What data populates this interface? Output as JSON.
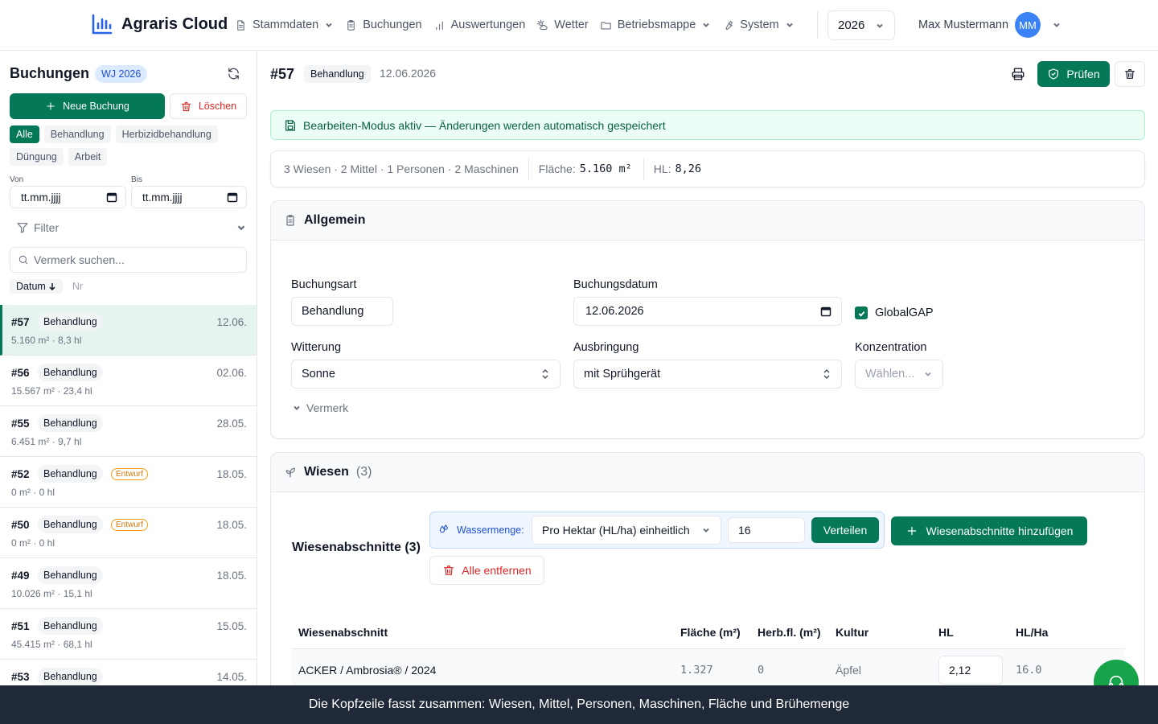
{
  "app": {
    "title": "Agraris Cloud",
    "accent_color": "#047857",
    "nav": [
      {
        "label": "Stammdaten",
        "icon": "document-icon",
        "dropdown": true
      },
      {
        "label": "Buchungen",
        "icon": "clipboard-icon",
        "dropdown": false
      },
      {
        "label": "Auswertungen",
        "icon": "bar-chart-icon",
        "dropdown": false
      },
      {
        "label": "Wetter",
        "icon": "weather-icon",
        "dropdown": false
      },
      {
        "label": "Betriebsmappe",
        "icon": "folder-icon",
        "dropdown": true
      },
      {
        "label": "System",
        "icon": "wrench-icon",
        "dropdown": true
      }
    ],
    "year": "2026",
    "user": {
      "name": "Max Mustermann",
      "initials": "MM"
    }
  },
  "sidebar": {
    "title": "Buchungen",
    "wj_badge": "WJ 2026",
    "new_label": "Neue Buchung",
    "delete_label": "Löschen",
    "chips": [
      {
        "label": "Alle",
        "active": true
      },
      {
        "label": "Behandlung",
        "active": false
      },
      {
        "label": "Herbizidbehandlung",
        "active": false
      },
      {
        "label": "Düngung",
        "active": false
      },
      {
        "label": "Arbeit",
        "active": false
      }
    ],
    "von_label": "Von",
    "bis_label": "Bis",
    "date_placeholder": "tt.mm.jjjj",
    "filter_label": "Filter",
    "search_placeholder": "Vermerk suchen...",
    "sort_active": "Datum",
    "sort_other": "Nr",
    "items": [
      {
        "nr": "#57",
        "type": "Behandlung",
        "draft": "",
        "date": "12.06.",
        "sub": "5.160 m² · 8,3 hl",
        "selected": true
      },
      {
        "nr": "#56",
        "type": "Behandlung",
        "draft": "",
        "date": "02.06.",
        "sub": "15.567 m² · 23,4 hl",
        "selected": false
      },
      {
        "nr": "#55",
        "type": "Behandlung",
        "draft": "",
        "date": "28.05.",
        "sub": "6.451 m² · 9,7 hl",
        "selected": false
      },
      {
        "nr": "#52",
        "type": "Behandlung",
        "draft": "Entwurf",
        "date": "18.05.",
        "sub": "0 m² · 0 hl",
        "selected": false
      },
      {
        "nr": "#50",
        "type": "Behandlung",
        "draft": "Entwurf",
        "date": "18.05.",
        "sub": "0 m² · 0 hl",
        "selected": false
      },
      {
        "nr": "#49",
        "type": "Behandlung",
        "draft": "",
        "date": "18.05.",
        "sub": "10.026 m² · 15,1 hl",
        "selected": false
      },
      {
        "nr": "#51",
        "type": "Behandlung",
        "draft": "",
        "date": "15.05.",
        "sub": "45.415 m² · 68,1 hl",
        "selected": false
      },
      {
        "nr": "#53",
        "type": "Behandlung",
        "draft": "",
        "date": "14.05.",
        "sub": "",
        "selected": false
      }
    ]
  },
  "main": {
    "nr": "#57",
    "type_badge": "Behandlung",
    "date": "12.06.2026",
    "check_label": "Prüfen",
    "edit_notice": "Bearbeiten-Modus aktiv — Änderungen werden automatisch gespeichert",
    "summary": {
      "counts": "3 Wiesen · 2 Mittel · 1 Personen · 2 Maschinen",
      "flaeche_label": "Fläche:",
      "flaeche_value": "5.160 m²",
      "hl_label": "HL:",
      "hl_value": "8,26"
    },
    "allgemein": {
      "title": "Allgemein",
      "buchungsart_label": "Buchungsart",
      "buchungsart_value": "Behandlung",
      "buchungsdatum_label": "Buchungsdatum",
      "buchungsdatum_value": "12.06.2026",
      "globalgap_label": "GlobalGAP",
      "globalgap_checked": true,
      "witterung_label": "Witterung",
      "witterung_value": "Sonne",
      "ausbringung_label": "Ausbringung",
      "ausbringung_value": "mit Sprühgerät",
      "konzentration_label": "Konzentration",
      "konzentration_placeholder": "Wählen...",
      "vermerk_label": "Vermerk"
    },
    "wiesen": {
      "title": "Wiesen",
      "count": "(3)",
      "section_title": "Wiesenabschnitte (3)",
      "wassermenge_label": "Wassermenge:",
      "wassermenge_mode": "Pro Hektar (HL/ha) einheitlich",
      "wassermenge_value": "16",
      "verteilen_label": "Verteilen",
      "add_label": "Wiesenabschnitte hinzufügen",
      "remove_all_label": "Alle entfernen",
      "columns": [
        "Wiesenabschnitt",
        "Fläche (m²)",
        "Herb.fl. (m²)",
        "Kultur",
        "HL",
        "HL/Ha"
      ],
      "rows": [
        {
          "name": "ACKER / Ambrosia® / 2024",
          "flaeche": "1.327",
          "herbfl": "0",
          "kultur": "Äpfel",
          "hl": "2,12",
          "hlha": "16.0"
        }
      ]
    }
  },
  "footer": {
    "caption": "Die Kopfzeile fasst zusammen: Wiesen, Mittel, Personen, Maschinen, Fläche und Brühemenge"
  }
}
